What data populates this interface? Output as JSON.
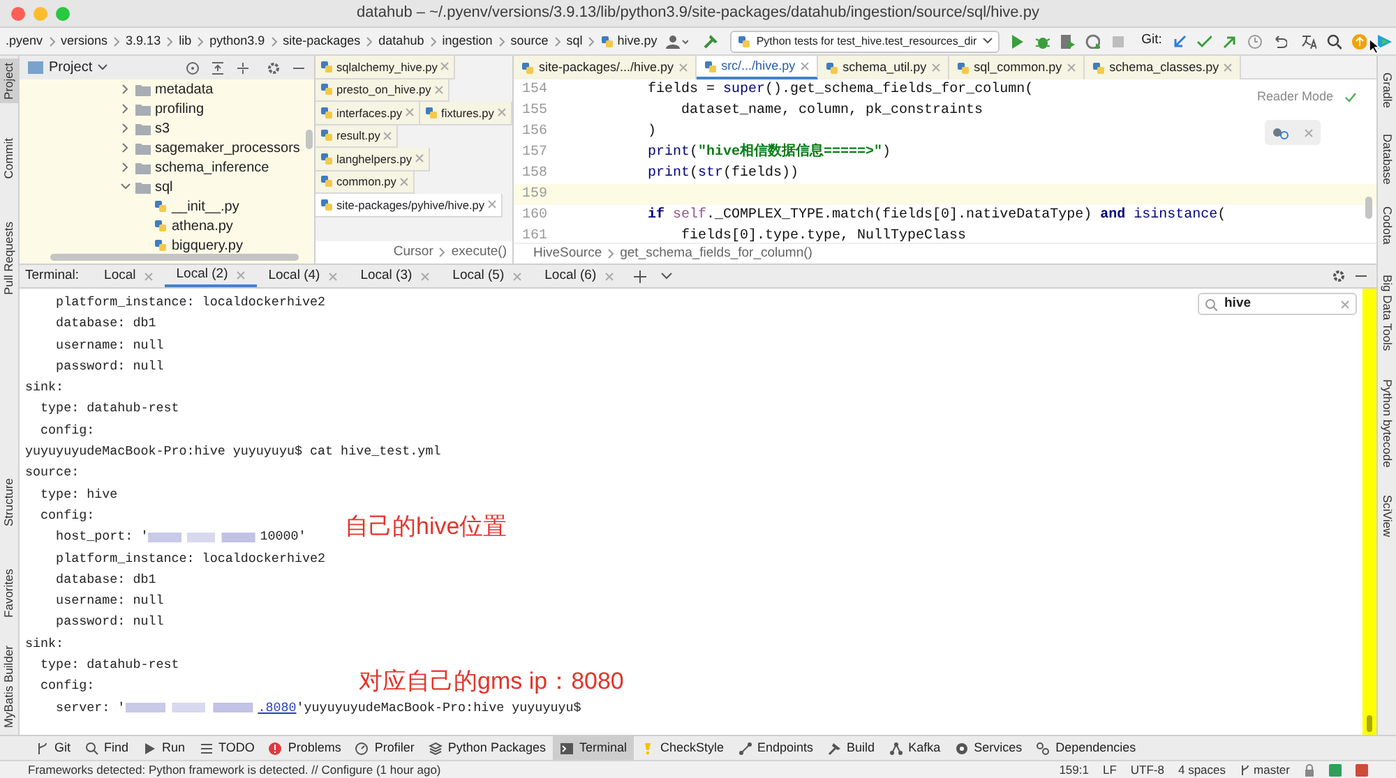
{
  "window": {
    "title": "datahub – ~/.pyenv/versions/3.9.13/lib/python3.9/site-packages/datahub/ingestion/source/sql/hive.py"
  },
  "navbar": {
    "breadcrumbs": [
      ".pyenv",
      "versions",
      "3.9.13",
      "lib",
      "python3.9",
      "site-packages",
      "datahub",
      "ingestion",
      "source",
      "sql",
      "hive.py"
    ],
    "run_config": "Python tests for test_hive.test_resources_dir",
    "git_label": "Git:"
  },
  "left_stripe": [
    {
      "label": "Project",
      "selected": true
    },
    {
      "label": "Commit",
      "selected": false
    },
    {
      "label": "Pull Requests",
      "selected": false
    },
    {
      "label": "Structure",
      "selected": false
    },
    {
      "label": "Favorites",
      "selected": false
    },
    {
      "label": "MyBatis Builder",
      "selected": false
    }
  ],
  "right_stripe": [
    "Gradle",
    "Database",
    "Codota",
    "Big Data Tools",
    "Python bytecode",
    "SciView"
  ],
  "project": {
    "title": "Project",
    "tree": [
      {
        "name": "metadata",
        "kind": "folder",
        "expanded": false
      },
      {
        "name": "profiling",
        "kind": "folder",
        "expanded": false
      },
      {
        "name": "s3",
        "kind": "folder",
        "expanded": false
      },
      {
        "name": "sagemaker_processors",
        "kind": "folder",
        "expanded": false
      },
      {
        "name": "schema_inference",
        "kind": "folder",
        "expanded": false
      },
      {
        "name": "sql",
        "kind": "folder",
        "expanded": true,
        "children": [
          {
            "name": "__init__.py",
            "kind": "file"
          },
          {
            "name": "athena.py",
            "kind": "file"
          },
          {
            "name": "bigquery.py",
            "kind": "file"
          }
        ]
      }
    ]
  },
  "editor": {
    "side_tabs": [
      {
        "label": "sqlalchemy_hive.py",
        "selected": false
      },
      {
        "label": "presto_on_hive.py",
        "selected": false
      },
      {
        "label": "interfaces.py",
        "selected": false
      },
      {
        "label": "fixtures.py",
        "selected": false
      },
      {
        "label": "result.py",
        "selected": false
      },
      {
        "label": "langhelpers.py",
        "selected": false
      },
      {
        "label": "common.py",
        "selected": false
      },
      {
        "label": "site-packages/pyhive/hive.py",
        "selected": true
      }
    ],
    "side_breadcrumbs": [
      "Cursor",
      "execute()"
    ],
    "tabs": [
      {
        "label": "site-packages/.../hive.py",
        "selected": false,
        "library": true
      },
      {
        "label": "src/.../hive.py",
        "selected": true,
        "library": false
      },
      {
        "label": "schema_util.py",
        "selected": false,
        "library": true
      },
      {
        "label": "sql_common.py",
        "selected": false,
        "library": true
      },
      {
        "label": "schema_classes.py",
        "selected": false,
        "library": true
      }
    ],
    "lines": [
      {
        "number": "154",
        "current": false,
        "tokens": [
          {
            "text": "        fields = ",
            "kind": "plain"
          },
          {
            "text": "super",
            "kind": "builtin"
          },
          {
            "text": "().get_schema_fields_for_column(",
            "kind": "plain"
          }
        ]
      },
      {
        "number": "155",
        "current": false,
        "tokens": [
          {
            "text": "            dataset_name, column, pk_constraints",
            "kind": "plain"
          }
        ]
      },
      {
        "number": "156",
        "current": false,
        "tokens": [
          {
            "text": "        )",
            "kind": "plain"
          }
        ]
      },
      {
        "number": "157",
        "current": false,
        "tokens": [
          {
            "text": "        print",
            "kind": "builtin"
          },
          {
            "text": "(",
            "kind": "plain"
          },
          {
            "text": "\"hive相信数据信息=====>\"",
            "kind": "string"
          },
          {
            "text": ")",
            "kind": "plain"
          }
        ]
      },
      {
        "number": "158",
        "current": false,
        "tokens": [
          {
            "text": "        print",
            "kind": "builtin"
          },
          {
            "text": "(",
            "kind": "plain"
          },
          {
            "text": "str",
            "kind": "builtin"
          },
          {
            "text": "(fields))",
            "kind": "plain"
          }
        ]
      },
      {
        "number": "159",
        "current": true
      },
      {
        "number": "160",
        "current": false,
        "tokens": [
          {
            "text": "        if",
            "kind": "keyword"
          },
          {
            "text": " self",
            "kind": "self"
          },
          {
            "text": "._COMPLEX_TYPE.match(fields[0].nativeDataType) ",
            "kind": "plain"
          },
          {
            "text": "and",
            "kind": "keyword"
          },
          {
            "text": " isinstance",
            "kind": "builtin"
          },
          {
            "text": "(",
            "kind": "plain"
          }
        ]
      },
      {
        "number": "161",
        "current": false,
        "tokens": [
          {
            "text": "            fields[0].type.type, NullTypeClass",
            "kind": "plain"
          }
        ]
      }
    ],
    "reader_mode": "Reader Mode",
    "breadcrumbs": [
      "HiveSource",
      "get_schema_fields_for_column()"
    ]
  },
  "terminal": {
    "title": "Terminal:",
    "tabs": [
      {
        "label": "Local",
        "selected": false
      },
      {
        "label": "Local (2)",
        "selected": true
      },
      {
        "label": "Local (4)",
        "selected": false
      },
      {
        "label": "Local (3)",
        "selected": false
      },
      {
        "label": "Local (5)",
        "selected": false
      },
      {
        "label": "Local (6)",
        "selected": false
      }
    ],
    "search": {
      "value": "hive"
    },
    "lines": [
      {
        "kind": "text",
        "text": "    platform_instance: localdockerhive2"
      },
      {
        "kind": "text",
        "text": "    database: db1"
      },
      {
        "kind": "text",
        "text": "    username: null"
      },
      {
        "kind": "text",
        "text": "    password: null"
      },
      {
        "kind": "text",
        "text": "sink:"
      },
      {
        "kind": "text",
        "text": "  type: datahub-rest"
      },
      {
        "kind": "text",
        "text": "  config:"
      },
      {
        "kind": "text",
        "text": "yuyuyuyudeMacBook-Pro:hive yuyuyuyu$ cat hive_test.yml"
      },
      {
        "kind": "text",
        "text": "source:"
      },
      {
        "kind": "text",
        "text": "  type: hive"
      },
      {
        "kind": "text",
        "text": "  config:"
      },
      {
        "kind": "redacted",
        "before": "    host_port: '",
        "after": "10000'"
      },
      {
        "kind": "text",
        "text": "    platform_instance: localdockerhive2"
      },
      {
        "kind": "text",
        "text": "    database: db1"
      },
      {
        "kind": "text",
        "text": "    username: null"
      },
      {
        "kind": "text",
        "text": "    password: null"
      },
      {
        "kind": "text",
        "text": "sink:"
      },
      {
        "kind": "text",
        "text": "  type: datahub-rest"
      },
      {
        "kind": "text",
        "text": "  config:"
      },
      {
        "kind": "redacted_link",
        "before": "    server: '",
        "link": ".8080",
        "after": "'yuyuyuyudeMacBook-Pro:hive yuyuyuyu$"
      }
    ],
    "annotations": [
      "自己的hive位置",
      "对应自己的gms ip：8080"
    ]
  },
  "toolbar": [
    {
      "label": "Git",
      "selected": false
    },
    {
      "label": "Find",
      "selected": false
    },
    {
      "label": "Run",
      "selected": false
    },
    {
      "label": "TODO",
      "selected": false
    },
    {
      "label": "Problems",
      "selected": false
    },
    {
      "label": "Profiler",
      "selected": false
    },
    {
      "label": "Python Packages",
      "selected": false
    },
    {
      "label": "Terminal",
      "selected": true
    },
    {
      "label": "CheckStyle",
      "selected": false
    },
    {
      "label": "Endpoints",
      "selected": false
    },
    {
      "label": "Build",
      "selected": false
    },
    {
      "label": "Kafka",
      "selected": false
    },
    {
      "label": "Services",
      "selected": false
    },
    {
      "label": "Dependencies",
      "selected": false
    }
  ],
  "status_bar": {
    "message": "Frameworks detected: Python framework is detected. // Configure (1 hour ago)",
    "position": "159:1",
    "line_separator": "LF",
    "encoding": "UTF-8",
    "indent": "4 spaces",
    "branch": "master"
  }
}
